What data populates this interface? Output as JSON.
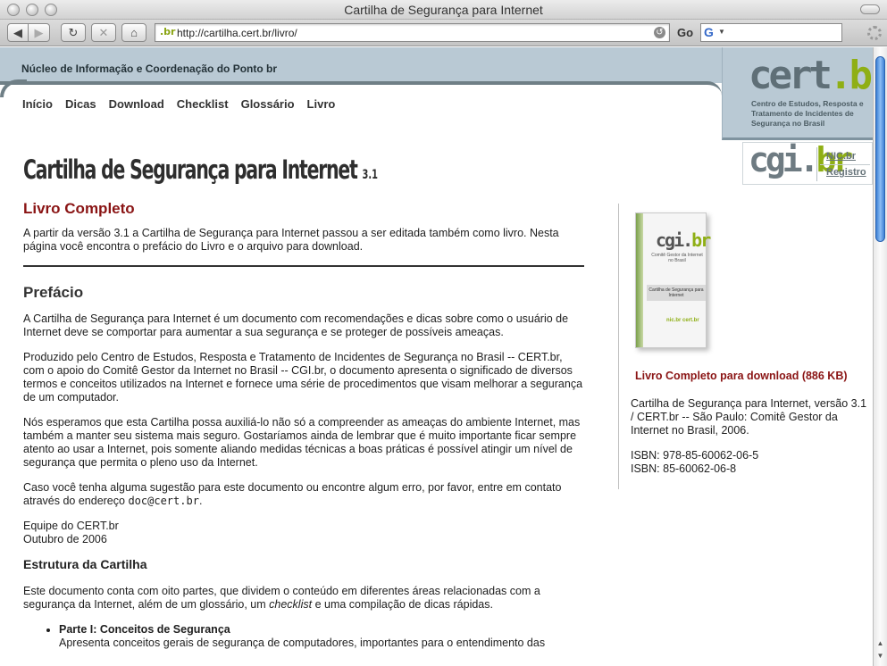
{
  "window": {
    "title": "Cartilha de Segurança para Internet"
  },
  "toolbar": {
    "back_icon": "◀",
    "forward_icon": "▶",
    "reload_icon": "↻",
    "stop_icon": "✕",
    "home_icon": "⌂",
    "url": "http://cartilha.cert.br/livro/",
    "favicon": ".br",
    "go_label": "Go",
    "search_engine": "G"
  },
  "header": {
    "org_name": "Núcleo de Informação e Coordenação do Ponto br",
    "nav": [
      "Início",
      "Dicas",
      "Download",
      "Checklist",
      "Glossário",
      "Livro"
    ]
  },
  "logos": {
    "cert_text": "cert",
    "cert_tld": "br",
    "cert_subtitle": "Centro de Estudos, Resposta e Tratamento de Incidentes de Segurança no Brasil",
    "cgi_text": "cgi",
    "cgi_tld": "br",
    "cgi_link_nic": "NIC.br",
    "cgi_link_registro": "Registro"
  },
  "page": {
    "title": "Cartilha de Segurança para Internet",
    "version": "3.1"
  },
  "main": {
    "section_title": "Livro Completo",
    "intro": "A partir da versão 3.1 a Cartilha de Segurança para Internet passou a ser editada também como livro. Nesta página você encontra o prefácio do Livro e o arquivo para download.",
    "preface_title": "Prefácio",
    "p1": "A Cartilha de Segurança para Internet é um documento com recomendações e dicas sobre como o usuário de Internet deve se comportar para aumentar a sua segurança e se proteger de possíveis ameaças.",
    "p2": "Produzido pelo Centro de Estudos, Resposta e Tratamento de Incidentes de Segurança no Brasil -- CERT.br, com o apoio do Comitê Gestor da Internet no Brasil -- CGI.br, o documento apresenta o significado de diversos termos e conceitos utilizados na Internet e fornece uma série de procedimentos que visam melhorar a segurança de um computador.",
    "p3": "Nós esperamos que esta Cartilha possa auxiliá-lo não só a compreender as ameaças do ambiente Internet, mas também a manter seu sistema mais seguro. Gostaríamos ainda de lembrar que é muito importante ficar sempre atento ao usar a Internet, pois somente aliando medidas técnicas a boas práticas é possível atingir um nível de segurança que permita o pleno uso da Internet.",
    "p4_before": "Caso você tenha alguma sugestão para este documento ou encontre algum erro, por favor, entre em contato através do endereço ",
    "p4_email": "doc@cert.br",
    "p4_after": ".",
    "signature_line1": "Equipe do CERT.br",
    "signature_line2": "Outubro de 2006",
    "structure_title": "Estrutura da Cartilha",
    "structure_before": "Este documento conta com oito partes, que dividem o conteúdo em diferentes áreas relacionadas com a segurança da Internet, além de um glossário, um ",
    "structure_em": "checklist",
    "structure_after": " e uma compilação de dicas rápidas.",
    "part1_title": "Parte I: Conceitos de Segurança",
    "part1_desc": "Apresenta conceitos gerais de segurança de computadores, importantes para o entendimento das"
  },
  "sidebar": {
    "book_logo_text": "cgi",
    "book_logo_tld": "br",
    "book_subtitle": "Comitê Gestor da Internet no Brasil",
    "book_band": "Cartilha de Segurança para Internet",
    "book_foot": "nic.br cert.br",
    "download_link": "Livro Completo para download (886 KB)",
    "citation": "Cartilha de Segurança para Internet, versão 3.1 / CERT.br -- São Paulo: Comitê Gestor da Internet no Brasil, 2006.",
    "isbn1": "ISBN: 978-85-60062-06-5",
    "isbn2": "ISBN: 85-60062-06-8"
  },
  "colors": {
    "accent_red": "#8a1414",
    "header_blue": "#b9c9d4",
    "brand_green": "#8faf15"
  }
}
